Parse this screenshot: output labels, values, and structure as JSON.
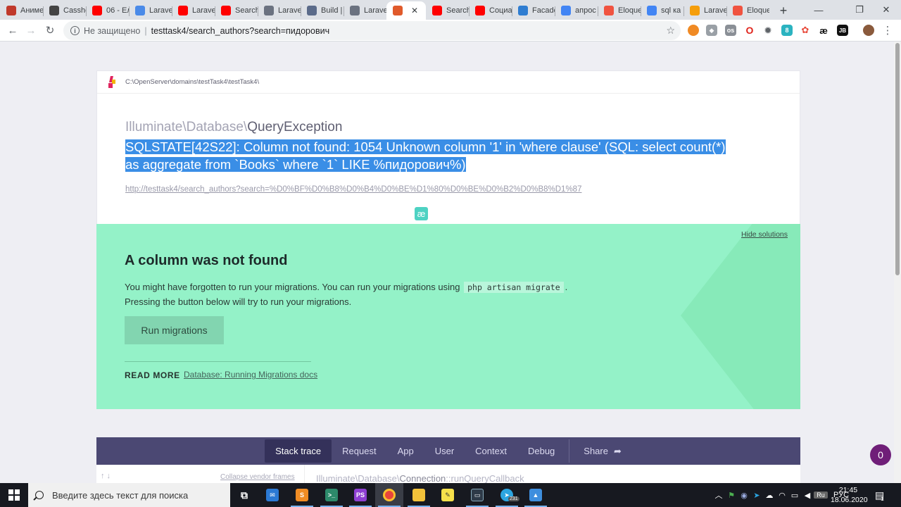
{
  "browser": {
    "tabs": [
      {
        "title": "Аниме",
        "icon": "anime-site-icon",
        "color": "#c0392b"
      },
      {
        "title": "Casshe",
        "icon": "casshern-icon",
        "color": "#444444"
      },
      {
        "title": "06 - Ел",
        "icon": "youtube-icon",
        "color": "#ff0000"
      },
      {
        "title": "Laravel",
        "icon": "translate-icon",
        "color": "#4a8ae8"
      },
      {
        "title": "Laravel",
        "icon": "youtube-icon",
        "color": "#ff0000"
      },
      {
        "title": "Search",
        "icon": "youtube-icon",
        "color": "#ff0000"
      },
      {
        "title": "Laravel",
        "icon": "globe-icon",
        "color": "#6b7280"
      },
      {
        "title": "Build |",
        "icon": "laravel-hub-icon",
        "color": "#5b6b8a"
      },
      {
        "title": "Laravel",
        "icon": "globe-icon",
        "color": "#6b7280"
      },
      {
        "title": "",
        "icon": "ignition-tab-icon",
        "color": "#e05a2b"
      },
      {
        "title": "Search",
        "icon": "youtube-icon",
        "color": "#ff0000"
      },
      {
        "title": "Социа",
        "icon": "youtube-icon",
        "color": "#ff0000"
      },
      {
        "title": "Facade",
        "icon": "vscode-icon",
        "color": "#2f7dd1"
      },
      {
        "title": "апрос",
        "icon": "google-icon",
        "color": "#4285f4"
      },
      {
        "title": "Eloque",
        "icon": "laravel-icon",
        "color": "#f05340"
      },
      {
        "title": "sql ка",
        "icon": "google-icon",
        "color": "#4285f4"
      },
      {
        "title": "Larave",
        "icon": "laracasts-icon",
        "color": "#f59e0b"
      },
      {
        "title": "Eloque",
        "icon": "laravel-icon",
        "color": "#f05340"
      }
    ],
    "active_tab_index": 9,
    "address": {
      "security": "Не защищено",
      "url": "testtask4/search_authors?search=пидорович"
    }
  },
  "ignition": {
    "path": "C:\\OpenServer\\domains\\testTask4\\testTask4\\",
    "exception_namespace": "Illuminate\\Database\\",
    "exception_class": "QueryException",
    "message": "SQLSTATE[42S22]: Column not found: 1054 Unknown column '1' in 'where clause' (SQL: select count(*) as aggregate from `Books` where `1` LIKE %пидорович%)",
    "request_url": "http://testtask4/search_authors?search=%D0%BF%D0%B8%D0%B4%D0%BE%D1%80%D0%BE%D0%B2%D0%B8%D1%87",
    "badge": "æ",
    "solution": {
      "hide_label": "Hide solutions",
      "title": "A column was not found",
      "desc_before": "You might have forgotten to run your migrations. You can run your migrations using",
      "desc_code": "php artisan migrate",
      "desc_after": ".",
      "desc_line2": "Pressing the button below will try to run your migrations.",
      "button": "Run migrations",
      "read_more": "READ MORE",
      "doc_link": "Database: Running Migrations docs"
    },
    "tabs": [
      "Stack trace",
      "Request",
      "App",
      "User",
      "Context",
      "Debug"
    ],
    "share": "Share",
    "collapse_vendor": "Collapse vendor frames",
    "frame_namespace": "Illuminate\\Database\\",
    "frame_class": "Connection",
    "frame_method": "::runQueryCallback",
    "notifications": "0"
  },
  "taskbar": {
    "search_placeholder": "Введите здесь текст для поиска",
    "telegram_badge": "231",
    "lang": "РУС",
    "time": "21:45",
    "date": "18.06.2020",
    "notif_count": "1"
  }
}
